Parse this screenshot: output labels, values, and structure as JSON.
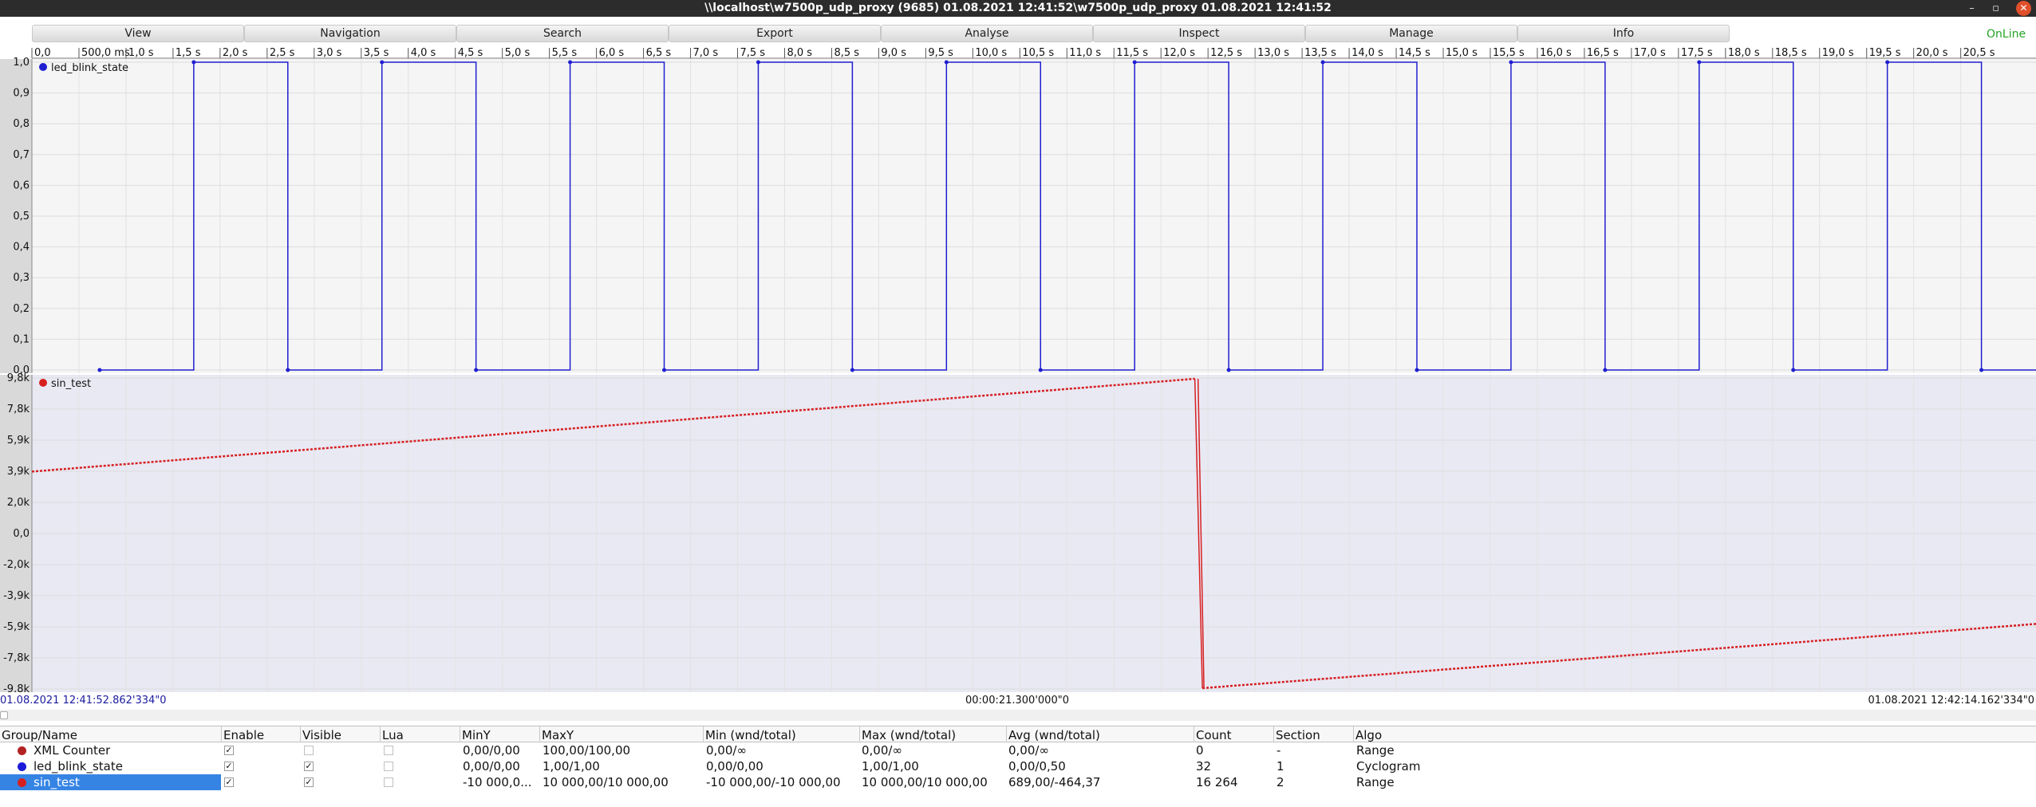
{
  "window": {
    "title": "\\\\localhost\\w7500p_udp_proxy (9685) 01.08.2021 12:41:52\\w7500p_udp_proxy 01.08.2021 12:41:52",
    "controls": {
      "minimize": "–",
      "maximize": "▫",
      "close": "✕"
    }
  },
  "menu": [
    "View",
    "Navigation",
    "Search",
    "Export",
    "Analyse",
    "Inspect",
    "Manage",
    "Info"
  ],
  "status": {
    "label": "OnLine",
    "color": "#23a323"
  },
  "time_axis": {
    "labels": [
      "0,0",
      "500,0 ms",
      "1,0 s",
      "1,5 s",
      "2,0 s",
      "2,5 s",
      "3,0 s",
      "3,5 s",
      "4,0 s",
      "4,5 s",
      "5,0 s",
      "5,5 s",
      "6,0 s",
      "6,5 s",
      "7,0 s",
      "7,5 s",
      "8,0 s",
      "8,5 s",
      "9,0 s",
      "9,5 s",
      "10,0 s",
      "10,5 s",
      "11,0 s",
      "11,5 s",
      "12,0 s",
      "12,5 s",
      "13,0 s",
      "13,5 s",
      "14,0 s",
      "14,5 s",
      "15,0 s",
      "15,5 s",
      "16,0 s",
      "16,5 s",
      "17,0 s",
      "17,5 s",
      "18,0 s",
      "18,5 s",
      "19,0 s",
      "19,5 s",
      "20,0 s",
      "20,5 s"
    ],
    "range_s": [
      0,
      21.3
    ]
  },
  "timeline": {
    "start": "01.08.2021 12:41:52.862'334\"0",
    "span": "00:00:21.300'000\"0",
    "end": "01.08.2021 12:42:14.162'334\"0"
  },
  "chart_data": [
    {
      "type": "line",
      "series": [
        {
          "name": "led_blink_state",
          "color": "#1f1fd0",
          "style": "step"
        }
      ],
      "ylim": [
        0,
        1
      ],
      "y_tick_labels": [
        "1,0",
        "0,9",
        "0,8",
        "0,7",
        "0,6",
        "0,5",
        "0,4",
        "0,3",
        "0,2",
        "0,1",
        "0,0"
      ],
      "x_unit": "s",
      "period_s": 2.0,
      "high_duration_s": 1.0,
      "rising_edges_s": [
        1.72,
        3.72,
        5.72,
        7.72,
        9.72,
        11.72,
        13.72,
        15.72,
        17.72,
        19.72
      ],
      "initial_value": 0,
      "background": "#f5f5f5"
    },
    {
      "type": "line",
      "series": [
        {
          "name": "sin_test",
          "color": "#d62020",
          "style": "line-markers"
        }
      ],
      "ylim": [
        -9800,
        9800
      ],
      "y_tick_labels": [
        "9,8k",
        "7,8k",
        "5,9k",
        "3,9k",
        "2,0k",
        "0,0",
        "-2,0k",
        "-3,9k",
        "-5,9k",
        "-7,8k",
        "-9,8k"
      ],
      "x_unit": "s",
      "points": [
        [
          0.0,
          3900
        ],
        [
          12.36,
          9750
        ],
        [
          12.44,
          -9750
        ],
        [
          21.3,
          -5700
        ]
      ],
      "background": "#e9e9f4"
    }
  ],
  "table": {
    "headers": [
      "Group/Name",
      "Enable",
      "Visible",
      "Lua",
      "MinY",
      "MaxY",
      "Min (wnd/total)",
      "Max (wnd/total)",
      "Avg (wnd/total)",
      "Count",
      "Section",
      "Algo"
    ],
    "rows": [
      {
        "color": "#b22222",
        "name": "XML Counter",
        "enable": true,
        "visible": false,
        "lua": false,
        "miny": "0,00/0,00",
        "maxy": "100,00/100,00",
        "min": "0,00/∞",
        "max": "0,00/∞",
        "avg": "0,00/∞",
        "count": "0",
        "section": "-",
        "algo": "Range",
        "selected": false
      },
      {
        "color": "#1a1ad8",
        "name": "led_blink_state",
        "enable": true,
        "visible": true,
        "lua": false,
        "miny": "0,00/0,00",
        "maxy": "1,00/1,00",
        "min": "0,00/0,00",
        "max": "1,00/1,00",
        "avg": "0,00/0,50",
        "count": "32",
        "section": "1",
        "algo": "Cyclogram",
        "selected": false
      },
      {
        "color": "#d62020",
        "name": "sin_test",
        "enable": true,
        "visible": true,
        "lua": false,
        "miny": "-10 000,0...",
        "maxy": "10 000,00/10 000,00",
        "min": "-10 000,00/-10 000,00",
        "max": "10 000,00/10 000,00",
        "avg": "689,00/-464,37",
        "count": "16 264",
        "section": "2",
        "algo": "Range",
        "selected": true
      }
    ],
    "check_mark": "✓"
  }
}
